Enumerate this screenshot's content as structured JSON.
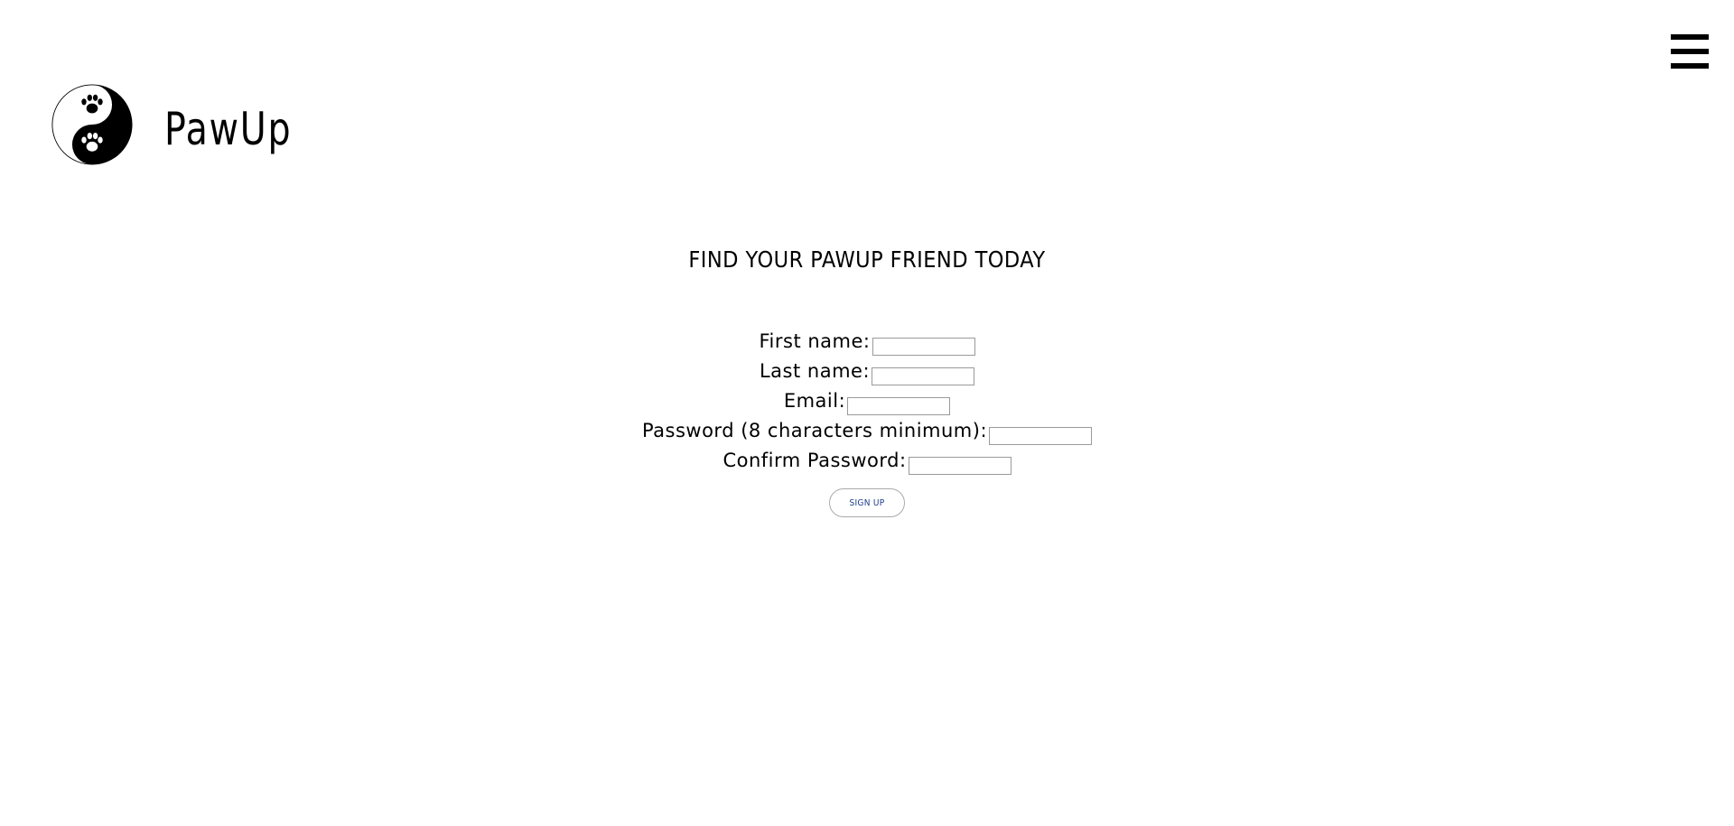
{
  "header": {
    "brand_name": "PawUp",
    "menu_icon": "hamburger-menu-icon",
    "logo_icon": "yin-yang-paw-icon"
  },
  "main": {
    "headline": "FIND YOUR PAWUP FRIEND TODAY"
  },
  "form": {
    "fields": [
      {
        "label": "First name:",
        "value": ""
      },
      {
        "label": "Last name:",
        "value": ""
      },
      {
        "label": "Email:",
        "value": ""
      },
      {
        "label": "Password (8 characters minimum):",
        "value": ""
      },
      {
        "label": "Confirm Password:",
        "value": ""
      }
    ],
    "submit_label": "SIGN UP"
  },
  "colors": {
    "background": "#ffffff",
    "text": "#000000",
    "button_text": "#1a3a8a"
  }
}
